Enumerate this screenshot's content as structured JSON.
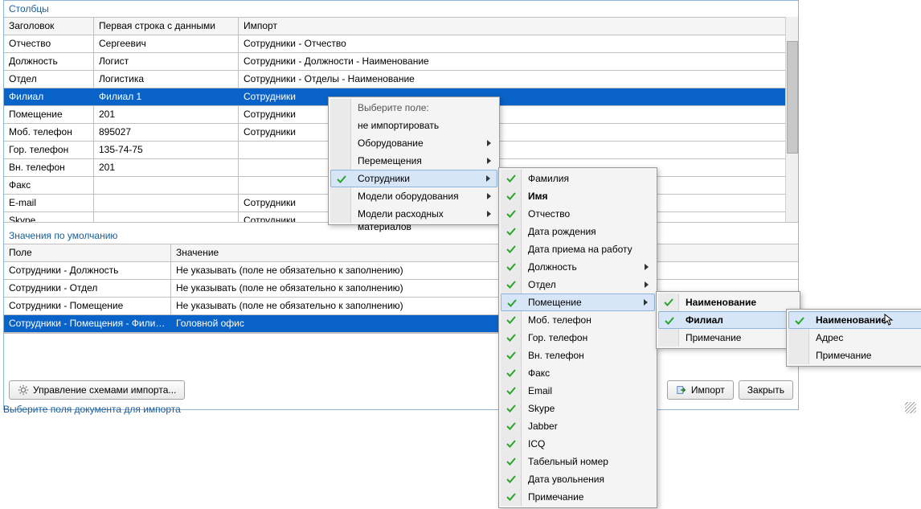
{
  "section1_title": "Столбцы",
  "columns_header": {
    "c0": "Заголовок",
    "c1": "Первая строка с данными",
    "c2": "Импорт"
  },
  "columns_rows": [
    {
      "c0": "Отчество",
      "c1": "Сергеевич",
      "c2": "Сотрудники - Отчество"
    },
    {
      "c0": "Должность",
      "c1": "Логист",
      "c2": "Сотрудники - Должности - Наименование"
    },
    {
      "c0": "Отдел",
      "c1": "Логистика",
      "c2": "Сотрудники - Отделы - Наименование"
    },
    {
      "c0": "Филиал",
      "c1": "Филиал 1",
      "c2": "Сотрудники",
      "selected": true
    },
    {
      "c0": "Помещение",
      "c1": "201",
      "c2": "Сотрудники"
    },
    {
      "c0": "Моб. телефон",
      "c1": "895027",
      "c2": "Сотрудники"
    },
    {
      "c0": "Гор. телефон",
      "c1": "135-74-75",
      "c2": ""
    },
    {
      "c0": "Вн. телефон",
      "c1": "201",
      "c2": ""
    },
    {
      "c0": "Факс",
      "c1": "",
      "c2": ""
    },
    {
      "c0": "E-mail",
      "c1": "",
      "c2": "Сотрудники"
    },
    {
      "c0": "Skype",
      "c1": "",
      "c2": "Сотрудники"
    }
  ],
  "section2_title": "Значения по умолчанию",
  "defaults_header": {
    "c0": "Поле",
    "c1": "Значение"
  },
  "defaults_rows": [
    {
      "c0": "Сотрудники - Должность",
      "c1": "Не указывать (поле не обязательно к заполнению)"
    },
    {
      "c0": "Сотрудники - Отдел",
      "c1": "Не указывать (поле не обязательно к заполнению)"
    },
    {
      "c0": "Сотрудники - Помещение",
      "c1": "Не указывать (поле не обязательно к заполнению)"
    },
    {
      "c0": "Сотрудники - Помещения - Филиал",
      "c1": "Головной офис",
      "selected": true
    }
  ],
  "btn_schemes": "Управление схемами импорта...",
  "btn_import": "Импорт",
  "btn_close": "Закрыть",
  "status": "Выберите поля документа для импорта",
  "menu1": {
    "title": "Выберите поле:",
    "items": [
      {
        "label": "не импортировать"
      },
      {
        "label": "Оборудование",
        "sub": true
      },
      {
        "label": "Перемещения",
        "sub": true
      },
      {
        "label": "Сотрудники",
        "sub": true,
        "check": true,
        "hover": true
      },
      {
        "label": "Модели оборудования",
        "sub": true
      },
      {
        "label": "Модели расходных материалов",
        "sub": true
      }
    ]
  },
  "menu2": {
    "items": [
      {
        "label": "Фамилия",
        "check": true
      },
      {
        "label": "Имя",
        "check": true,
        "bold": true
      },
      {
        "label": "Отчество",
        "check": true
      },
      {
        "label": "Дата рождения",
        "check": true
      },
      {
        "label": "Дата приема на работу",
        "check": true
      },
      {
        "label": "Должность",
        "check": true,
        "sub": true
      },
      {
        "label": "Отдел",
        "check": true,
        "sub": true
      },
      {
        "label": "Помещение",
        "check": true,
        "sub": true,
        "hover": true
      },
      {
        "label": "Моб. телефон",
        "check": true
      },
      {
        "label": "Гор. телефон",
        "check": true
      },
      {
        "label": "Вн. телефон",
        "check": true
      },
      {
        "label": "Факс",
        "check": true
      },
      {
        "label": "Email",
        "check": true
      },
      {
        "label": "Skype",
        "check": true
      },
      {
        "label": "Jabber",
        "check": true
      },
      {
        "label": "ICQ",
        "check": true
      },
      {
        "label": "Табельный номер",
        "check": true
      },
      {
        "label": "Дата увольнения",
        "check": true
      },
      {
        "label": "Примечание",
        "check": true
      }
    ]
  },
  "menu3": {
    "items": [
      {
        "label": "Наименование",
        "check": true,
        "bold": true
      },
      {
        "label": "Филиал",
        "check": true,
        "sub": true,
        "bold": true,
        "hover": true
      },
      {
        "label": "Примечание"
      }
    ]
  },
  "menu4": {
    "items": [
      {
        "label": "Наименование",
        "check": true,
        "bold": true,
        "hover": true
      },
      {
        "label": "Адрес"
      },
      {
        "label": "Примечание"
      }
    ]
  }
}
